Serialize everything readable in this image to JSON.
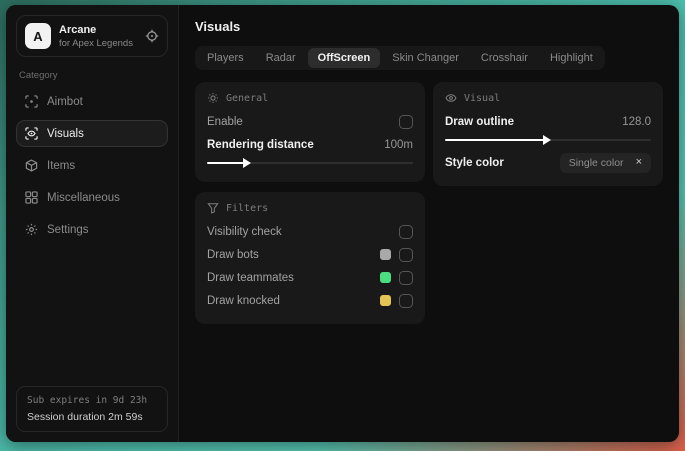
{
  "app": {
    "logo_letter": "A",
    "title": "Arcane",
    "subtitle": "for Apex Legends"
  },
  "sidebar": {
    "category_label": "Category",
    "items": [
      {
        "label": "Aimbot",
        "icon": "aim-target-icon"
      },
      {
        "label": "Visuals",
        "icon": "eye-scan-icon",
        "active": true
      },
      {
        "label": "Items",
        "icon": "box-icon"
      },
      {
        "label": "Miscellaneous",
        "icon": "grid-icon"
      },
      {
        "label": "Settings",
        "icon": "gear-icon"
      }
    ],
    "footer": {
      "sub_expires": "Sub expires in 9d 23h",
      "session_duration": "Session duration 2m 59s"
    }
  },
  "main": {
    "title": "Visuals",
    "active_tab": "OffScreen",
    "tabs": [
      {
        "label": "Players"
      },
      {
        "label": "Radar"
      },
      {
        "label": "OffScreen"
      },
      {
        "label": "Skin Changer"
      },
      {
        "label": "Crosshair"
      },
      {
        "label": "Highlight"
      }
    ]
  },
  "panels": {
    "general": {
      "title": "General",
      "enable_label": "Enable",
      "enable_checked": false,
      "rendering_distance_label": "Rendering distance",
      "rendering_distance_value": "100m",
      "rendering_distance_fill": "20%"
    },
    "visual": {
      "title": "Visual",
      "draw_outline_label": "Draw outline",
      "draw_outline_value": "128.0",
      "draw_outline_fill": "50%",
      "style_color_label": "Style color",
      "style_color_value": "Single color",
      "clear_glyph": "×"
    },
    "filters": {
      "title": "Filters",
      "rows": [
        {
          "label": "Visibility check",
          "checked": false
        },
        {
          "label": "Draw bots",
          "color": "#a9a9a9",
          "checked": false
        },
        {
          "label": "Draw teammates",
          "color": "#4ade80",
          "checked": false
        },
        {
          "label": "Draw knocked",
          "color": "#e4c554",
          "checked": false
        }
      ]
    }
  }
}
